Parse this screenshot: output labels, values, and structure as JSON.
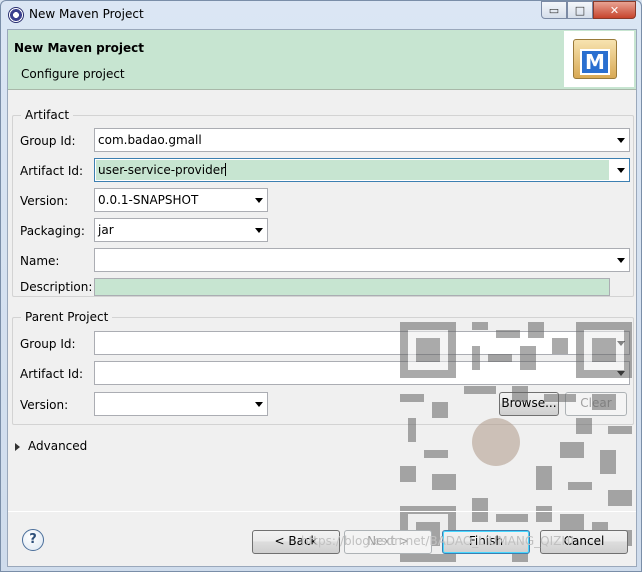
{
  "window": {
    "title": "New Maven Project",
    "controls": {
      "minimize": "▭",
      "maximize": "□",
      "close": "✕"
    }
  },
  "header": {
    "title": "New Maven project",
    "subtitle": "Configure project",
    "logo_letter": "M"
  },
  "artifact": {
    "group_label": "Artifact",
    "group_id": {
      "label": "Group Id:",
      "value": "com.badao.gmall"
    },
    "artifact_id": {
      "label": "Artifact Id:",
      "value": "user-service-provider"
    },
    "version": {
      "label": "Version:",
      "value": "0.0.1-SNAPSHOT"
    },
    "packaging": {
      "label": "Packaging:",
      "value": "jar"
    },
    "name": {
      "label": "Name:",
      "value": ""
    },
    "description": {
      "label": "Description:",
      "value": ""
    }
  },
  "parent": {
    "group_label": "Parent Project",
    "group_id": {
      "label": "Group Id:",
      "value": ""
    },
    "artifact_id": {
      "label": "Artifact Id:",
      "value": ""
    },
    "version": {
      "label": "Version:",
      "value": ""
    },
    "browse_label": "Browse...",
    "clear_label": "Clear"
  },
  "advanced_label": "Advanced",
  "footer": {
    "help_label": "?",
    "back_label": "< Back",
    "next_label": "Next >",
    "finish_label": "Finish",
    "cancel_label": "Cancel"
  },
  "watermark_text": "https://blog.csdn.net/BADAO_LIUMANG_QIZHI",
  "colors": {
    "header_bg": "#c7e5d1",
    "required_field_bg": "#c7e5d1"
  }
}
